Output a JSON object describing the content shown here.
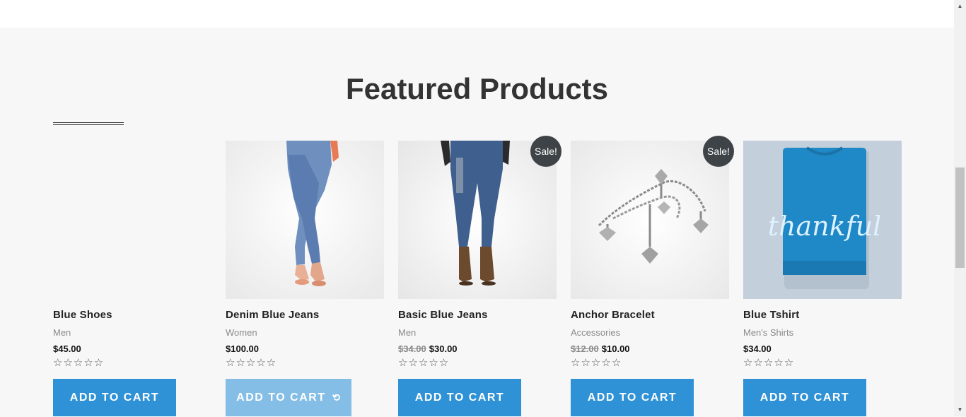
{
  "section": {
    "title": "Featured Products"
  },
  "products": [
    {
      "name": "Blue Shoes",
      "category": "Men",
      "old_price": "",
      "price": "$45.00",
      "sale_badge": "",
      "stars": "☆☆☆☆☆",
      "cart_label": "ADD TO CART",
      "loading_icon": ""
    },
    {
      "name": "Denim Blue Jeans",
      "category": "Women",
      "old_price": "",
      "price": "$100.00",
      "sale_badge": "",
      "stars": "☆☆☆☆☆",
      "cart_label": "ADD TO CART",
      "loading_icon": "⟲"
    },
    {
      "name": "Basic Blue Jeans",
      "category": "Men",
      "old_price": "$34.00",
      "price": "$30.00",
      "sale_badge": "Sale!",
      "stars": "☆☆☆☆☆",
      "cart_label": "ADD TO CART",
      "loading_icon": ""
    },
    {
      "name": "Anchor Bracelet",
      "category": "Accessories",
      "old_price": "$12.00",
      "price": "$10.00",
      "sale_badge": "Sale!",
      "stars": "☆☆☆☆☆",
      "cart_label": "ADD TO CART",
      "loading_icon": ""
    },
    {
      "name": "Blue Tshirt",
      "category": "Men's Shirts",
      "old_price": "",
      "price": "$34.00",
      "sale_badge": "",
      "stars": "☆☆☆☆☆",
      "cart_label": "ADD TO CART",
      "loading_icon": ""
    }
  ],
  "tshirt_print": "thankful",
  "colors": {
    "accent": "#2f91d6",
    "accent_loading": "#84bde6",
    "sale_badge": "#3e4347",
    "background": "#f7f7f7"
  },
  "icons": {
    "rating": "star-outline-icon",
    "loading": "spinner-icon",
    "scroll_up": "scroll-up-arrow-icon",
    "scroll_down": "scroll-down-arrow-icon"
  }
}
